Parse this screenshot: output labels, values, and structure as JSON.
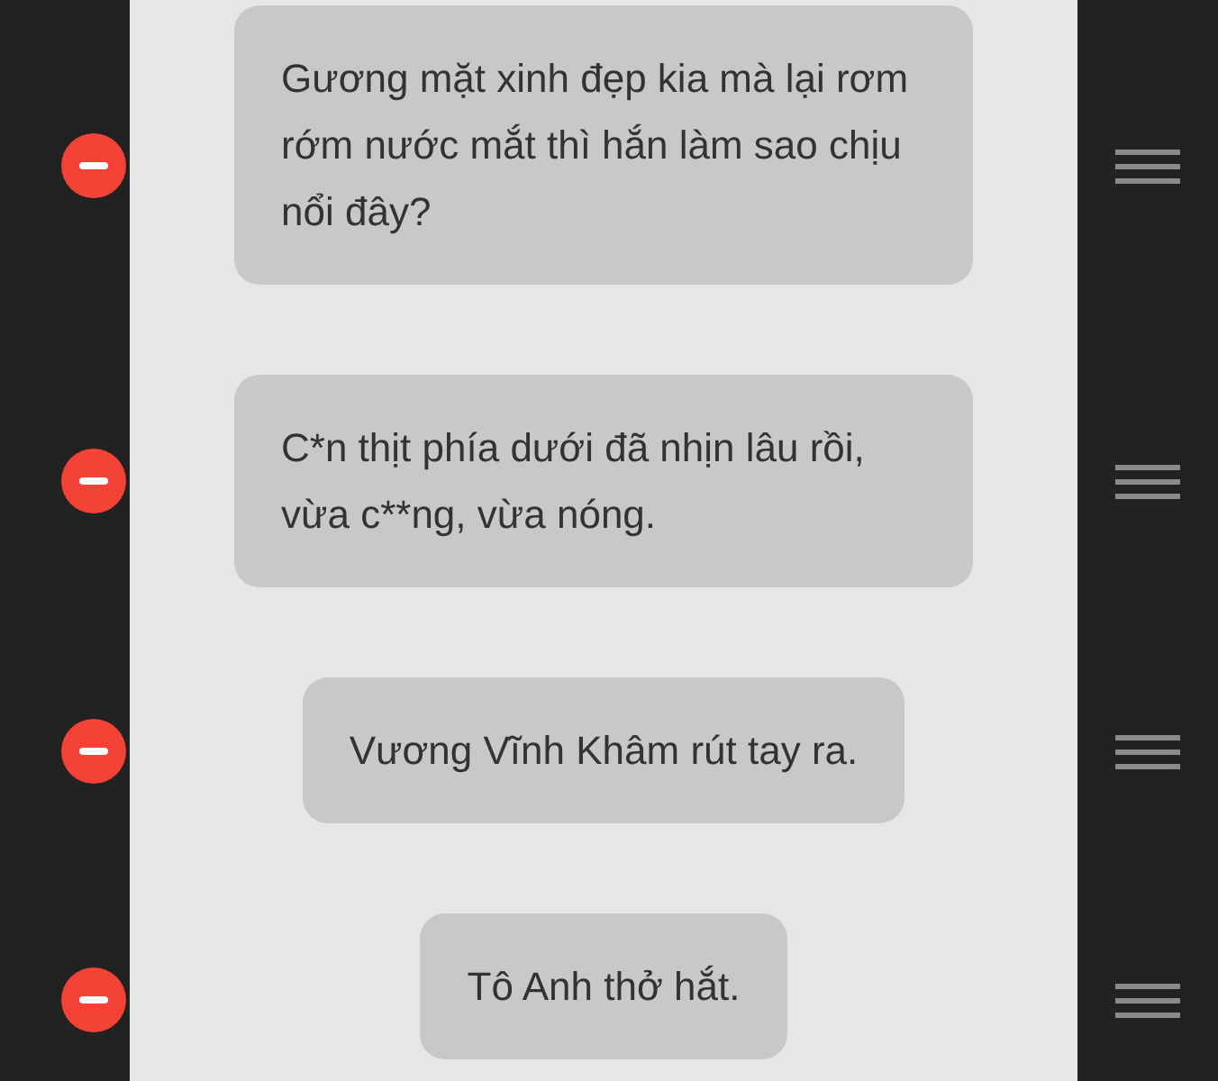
{
  "messages": [
    {
      "text": "Gương mặt xinh đẹp kia mà lại rơm rớm nước mắt thì hắn làm sao chịu nổi đây?"
    },
    {
      "text": "C*n thịt phía dưới đã nhịn lâu rồi, vừa c**ng, vừa nóng."
    },
    {
      "text": "Vương Vĩnh Khâm rút tay ra."
    },
    {
      "text": "Tô Anh thở hắt."
    }
  ]
}
